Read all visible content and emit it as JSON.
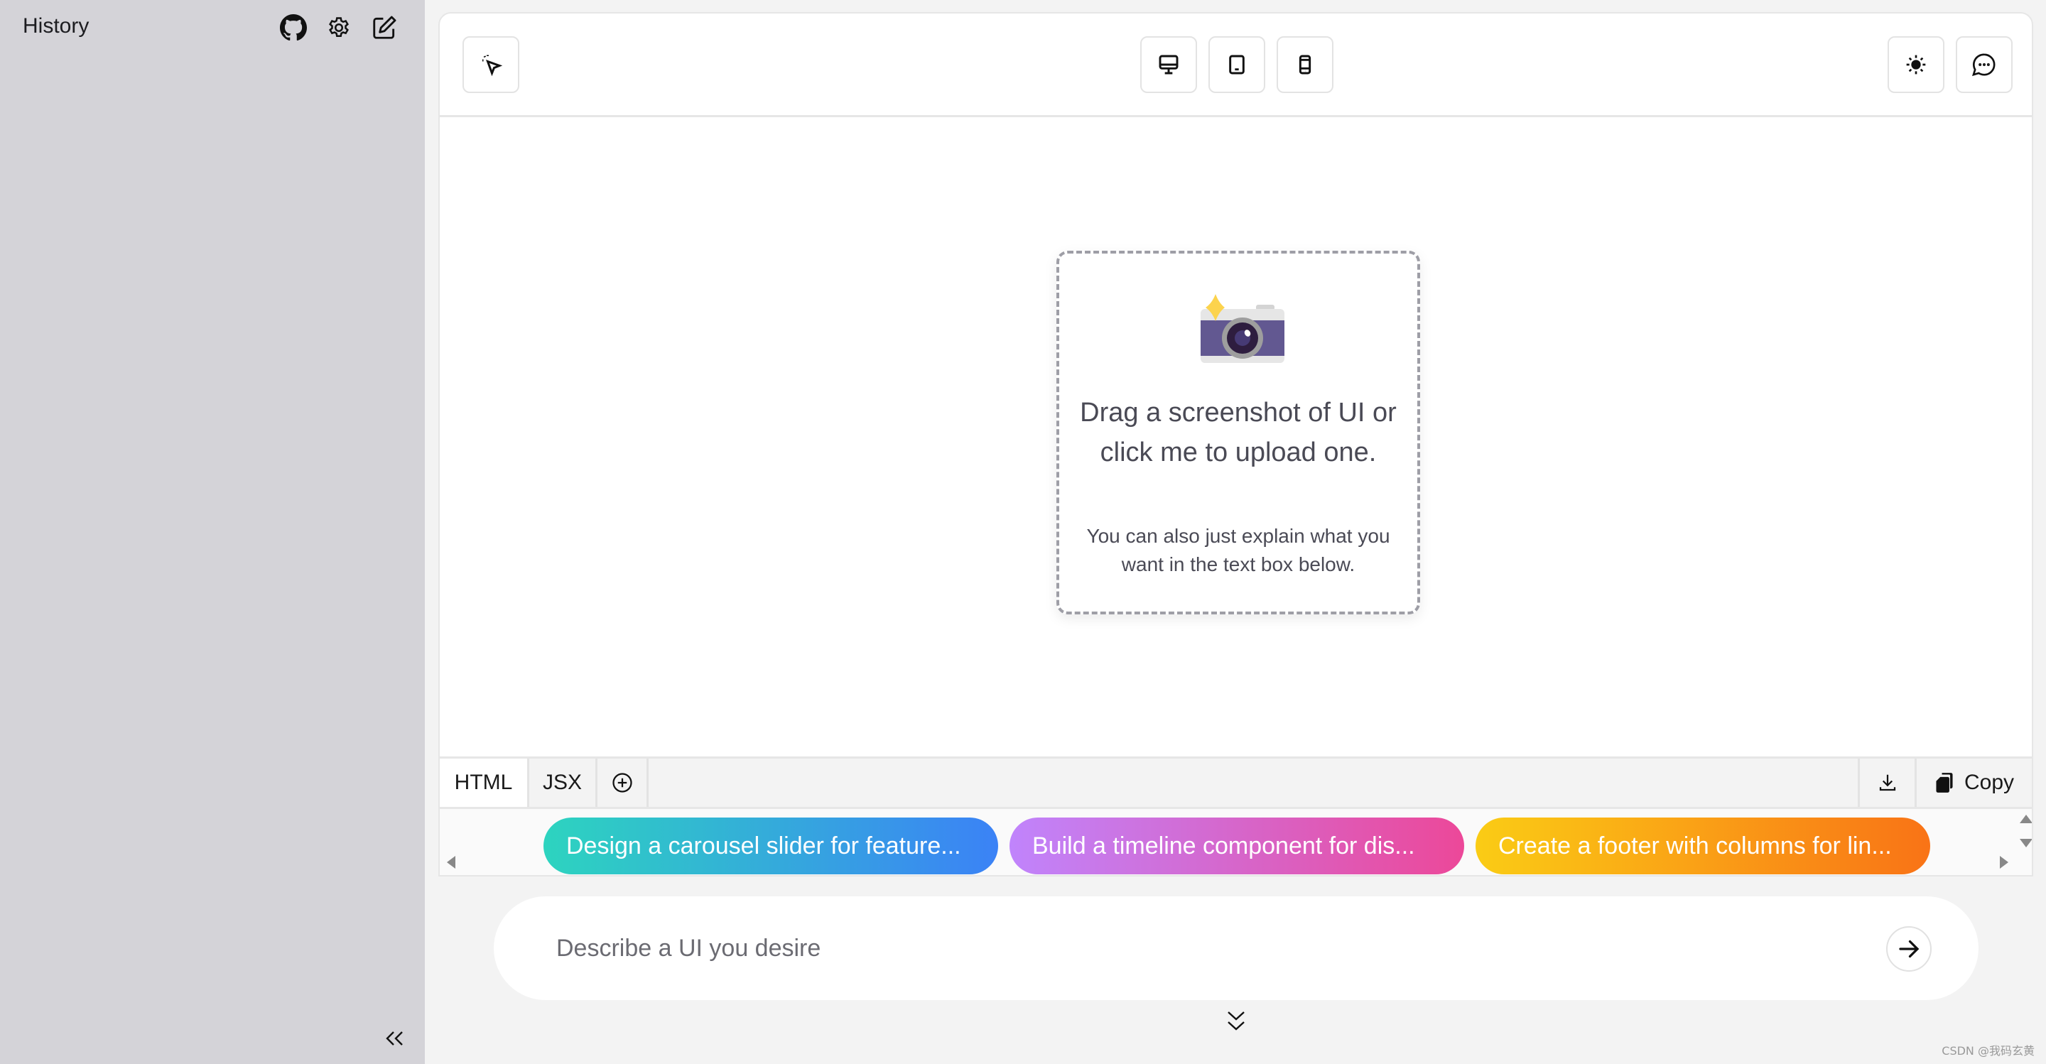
{
  "sidebar": {
    "title": "History",
    "icons": [
      "github-icon",
      "gear-icon",
      "new-chat-icon"
    ],
    "collapse_icon": "double-chevron-left-icon"
  },
  "toolbar": {
    "left": [
      "select-element-icon"
    ],
    "devices": [
      "desktop-icon",
      "tablet-icon",
      "mobile-icon"
    ],
    "right": [
      "sun-icon",
      "chat-icon"
    ]
  },
  "upload": {
    "main_text": "Drag a screenshot of UI or click me to upload one.",
    "sub_text": "You can also just explain what you want in the text box below."
  },
  "tabs": {
    "items": [
      {
        "label": "HTML",
        "active": true
      },
      {
        "label": "JSX",
        "active": false
      }
    ],
    "add_icon": "plus-circle-icon",
    "download_icon": "download-icon",
    "copy_label": "Copy"
  },
  "suggestions": [
    {
      "label": "Design a carousel slider for feature...",
      "from": "#2dd4bf",
      "to": "#3b82f6"
    },
    {
      "label": "Build a timeline component for dis...",
      "from": "#c084fc",
      "to": "#ec4899"
    },
    {
      "label": "Create a footer with columns for lin...",
      "from": "#facc15",
      "to": "#f97316"
    }
  ],
  "prompt": {
    "placeholder": "Describe a UI you desire",
    "value": ""
  },
  "watermark": "CSDN @我码玄黄"
}
